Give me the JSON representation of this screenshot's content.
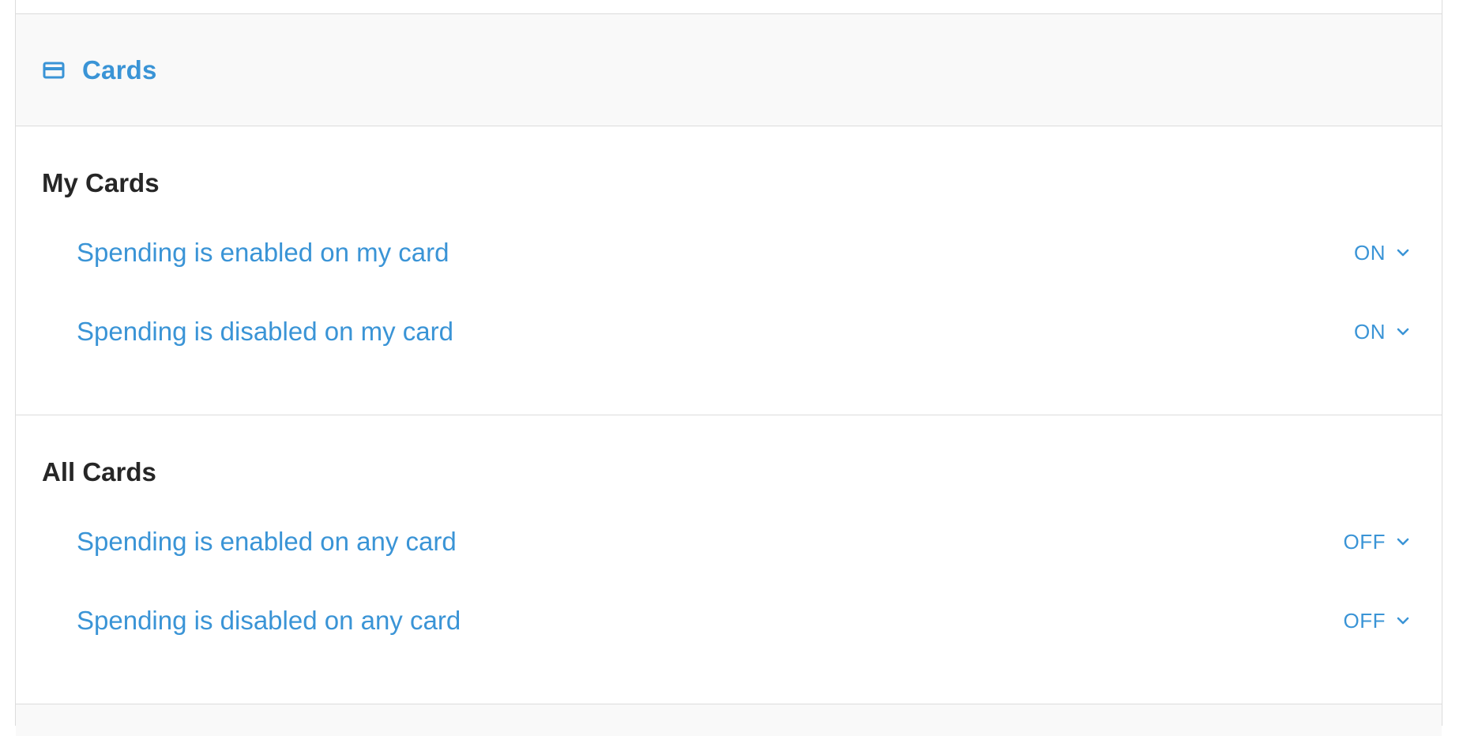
{
  "header": {
    "title": "Cards",
    "icon": "credit-card-icon"
  },
  "sections": [
    {
      "title": "My Cards",
      "rows": [
        {
          "label": "Spending is enabled on my card",
          "value": "ON"
        },
        {
          "label": "Spending is disabled on my card",
          "value": "ON"
        }
      ]
    },
    {
      "title": "All Cards",
      "rows": [
        {
          "label": "Spending is enabled on any card",
          "value": "OFF"
        },
        {
          "label": "Spending is disabled on any card",
          "value": "OFF"
        }
      ]
    }
  ],
  "colors": {
    "accent": "#3a94d6",
    "heading": "#262626",
    "header_bg": "#f9f9f9",
    "border": "#dcdcdc"
  }
}
